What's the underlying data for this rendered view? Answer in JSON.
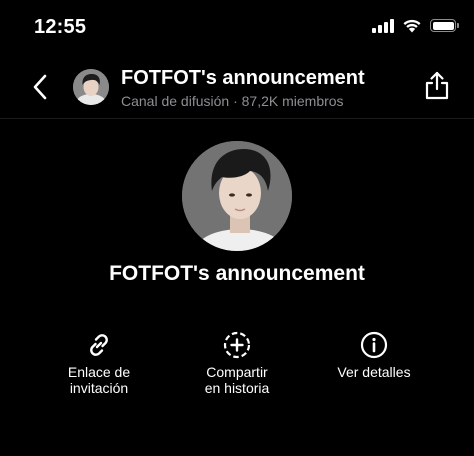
{
  "status_bar": {
    "time": "12:55"
  },
  "header": {
    "title": "FOTFOT's announcement",
    "subtitle": "Canal de difusión · 87,2K miembros"
  },
  "profile": {
    "name": "FOTFOT's announcement"
  },
  "actions": [
    {
      "label": "Enlace de\ninvitación",
      "icon": "link-icon"
    },
    {
      "label": "Compartir\nen historia",
      "icon": "add-story-icon"
    },
    {
      "label": "Ver detalles",
      "icon": "info-icon"
    }
  ],
  "colors": {
    "background": "#000000",
    "text": "#ffffff",
    "secondary_text": "#8e8e93"
  }
}
